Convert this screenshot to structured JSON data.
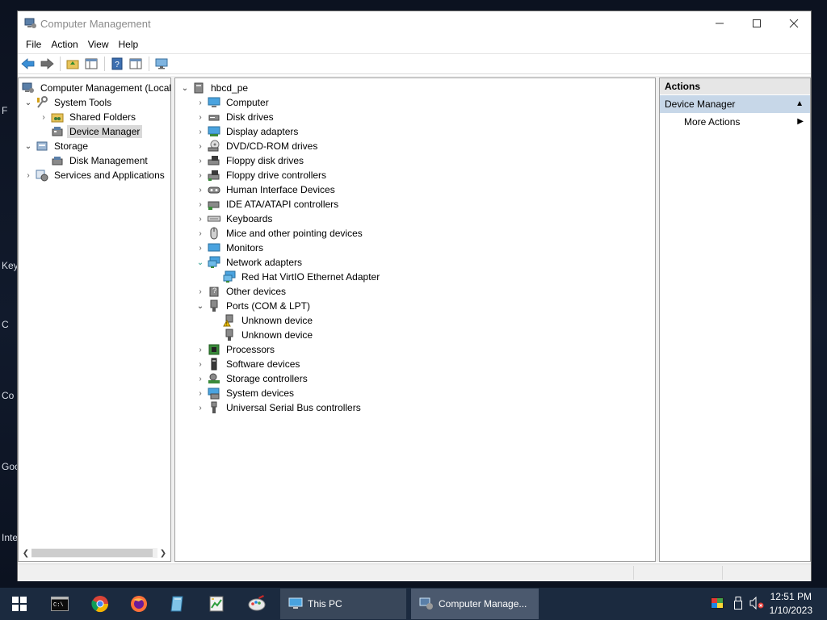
{
  "desktop": {
    "labels": [
      "F",
      "Key",
      "C",
      "Co",
      "Goo",
      "Inte"
    ]
  },
  "window": {
    "title": "Computer Management",
    "menu": [
      "File",
      "Action",
      "View",
      "Help"
    ]
  },
  "left_tree": {
    "root": "Computer Management (Local",
    "system_tools": "System Tools",
    "shared_folders": "Shared Folders",
    "device_manager": "Device Manager",
    "storage": "Storage",
    "disk_management": "Disk Management",
    "services_apps": "Services and Applications"
  },
  "device_tree": {
    "root": "hbcd_pe",
    "items": [
      "Computer",
      "Disk drives",
      "Display adapters",
      "DVD/CD-ROM drives",
      "Floppy disk drives",
      "Floppy drive controllers",
      "Human Interface Devices",
      "IDE ATA/ATAPI controllers",
      "Keyboards",
      "Mice and other pointing devices",
      "Monitors",
      "Network adapters",
      "Red Hat VirtIO Ethernet Adapter",
      "Other devices",
      "Ports (COM & LPT)",
      "Unknown device",
      "Unknown device",
      "Processors",
      "Software devices",
      "Storage controllers",
      "System devices",
      "Universal Serial Bus controllers"
    ]
  },
  "actions": {
    "header": "Actions",
    "section": "Device Manager",
    "more": "More Actions"
  },
  "taskbar": {
    "this_pc": "This PC",
    "computer_management": "Computer Manage...",
    "time": "12:51 PM",
    "date": "1/10/2023"
  },
  "colors": {
    "taskbar_bg": "#1b2a3f",
    "actions_section_bg": "#c7d7e8",
    "selection_bg": "#d9d9d9"
  }
}
